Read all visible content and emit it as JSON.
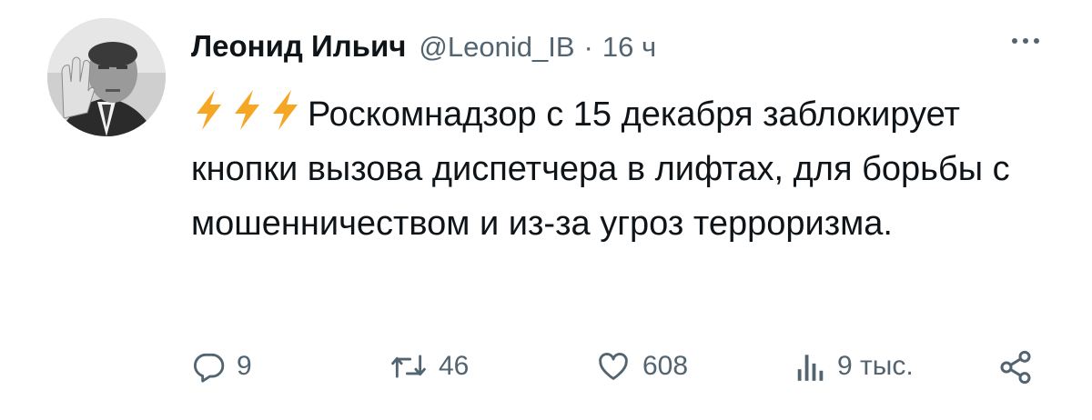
{
  "author": {
    "display_name": "Леонид Ильич",
    "handle": "@Leonid_IB",
    "separator": "·",
    "time": "16 ч"
  },
  "tweet": {
    "lead_icons": [
      "lightning-emoji",
      "lightning-emoji",
      "lightning-emoji"
    ],
    "text": "Роскомнадзор с 15 декабря заблокирует кнопки вызова диспетчера в лифтах, для борьбы с мошенничеством и из-за угроз терроризма."
  },
  "actions": {
    "replies": "9",
    "reposts": "46",
    "likes": "608",
    "views": "9 тыс."
  },
  "colors": {
    "text": "#0f1419",
    "secondary": "#536471",
    "lightning": "#f5a623"
  },
  "icons": {
    "more": "more-dots-icon",
    "reply": "reply-icon",
    "repost": "repost-icon",
    "like": "heart-icon",
    "views": "views-icon",
    "share": "share-icon"
  }
}
